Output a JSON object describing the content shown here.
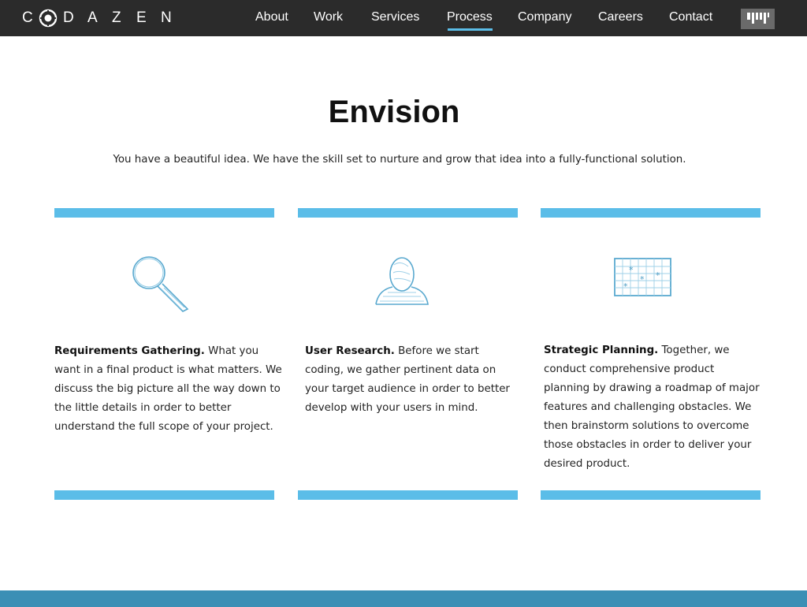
{
  "header": {
    "logo_letters": [
      "C",
      "D",
      "A",
      "Z",
      "E",
      "N"
    ],
    "nav": [
      {
        "label": "About",
        "active": false
      },
      {
        "label": "Work",
        "active": false
      },
      {
        "label": "Services",
        "active": false
      },
      {
        "label": "Process",
        "active": true
      },
      {
        "label": "Company",
        "active": false
      },
      {
        "label": "Careers",
        "active": false
      },
      {
        "label": "Contact",
        "active": false
      }
    ],
    "menu_icon": "barcode-menu-icon"
  },
  "main": {
    "title": "Envision",
    "subtitle": "You have a beautiful idea. We have the skill set to nurture and grow that idea into a fully-functional solution.",
    "cards": [
      {
        "icon": "magnifying-glass-icon",
        "heading": "Requirements Gathering.",
        "body": "What you want in a final product is what matters. We discuss the big picture all the way down to the little details in order to better understand the full scope of your project."
      },
      {
        "icon": "user-silhouette-icon",
        "heading": "User Research.",
        "body": "Before we start coding, we gather pertinent data on your target audience in order to better develop with your users in mind."
      },
      {
        "icon": "star-map-icon",
        "heading": "Strategic Planning.",
        "body": "Together, we conduct comprehensive product planning by drawing a roadmap of major features and challenging obstacles. We then brainstorm solutions to overcome those obstacles in order to deliver your desired product."
      }
    ]
  },
  "colors": {
    "header_bg": "#2b2b2b",
    "accent": "#5bbde8",
    "footer": "#3b8fb5"
  }
}
